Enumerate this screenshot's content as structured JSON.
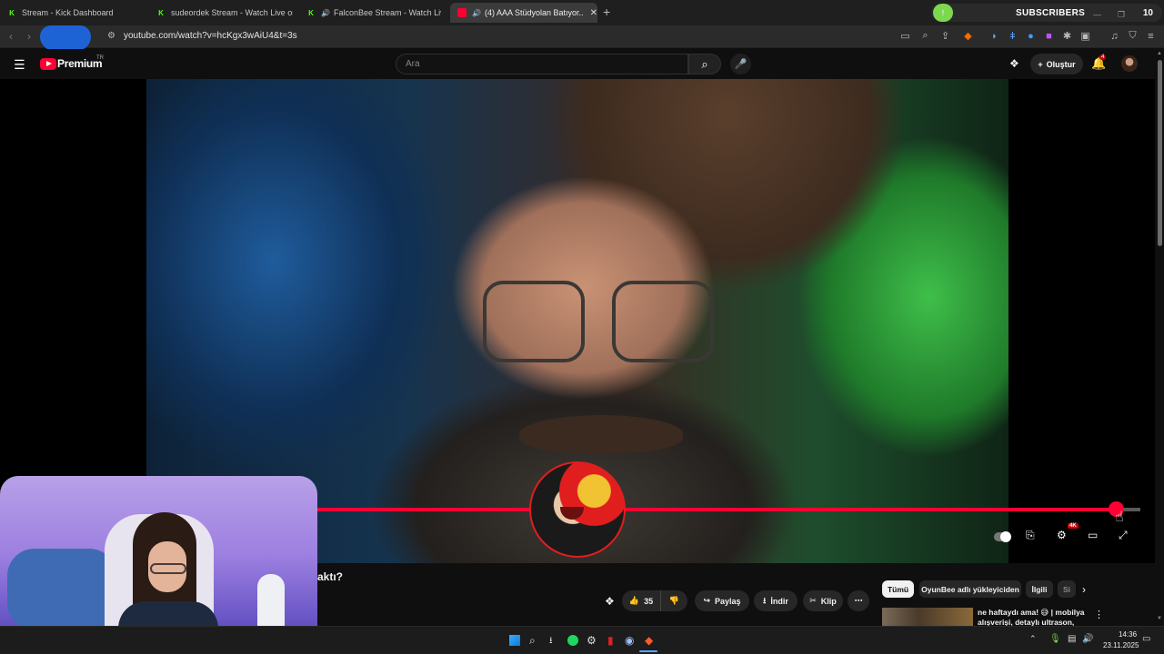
{
  "browser": {
    "tabs": [
      {
        "title": "Stream - Kick Dashboard"
      },
      {
        "title": "sudeordek Stream - Watch Live on K"
      },
      {
        "title": "FalconBee Stream - Watch Live on"
      },
      {
        "title": "(4) AAA Stüdyolan Batıyor..."
      }
    ],
    "url": "youtube.com/watch?v=hcKgx3wAiU4&t=3s"
  },
  "subs_widget": {
    "label": "SUBSCRIBERS",
    "count": "10"
  },
  "youtube": {
    "brand": "Premium",
    "region": "TR",
    "search_placeholder": "Ara",
    "create_label": "Oluştur",
    "notification_count": "4"
  },
  "player": {
    "progress": 0.97,
    "quality_badge": "4K",
    "colors": {
      "progress": "#ff0033"
    }
  },
  "video": {
    "title_fragment": "aktı?",
    "likes": "35",
    "share_label": "Paylaş",
    "download_label": "İndir",
    "clip_label": "Klip"
  },
  "chips": [
    "Tümü",
    "OyunBee adlı yükleyiciden",
    "İlgili",
    "Si"
  ],
  "recommendation": {
    "title": "ne haftaydı ama! 😅 | mobilya alışverişi, detaylı ultrason, bolc"
  },
  "taskbar": {
    "time": "14:36",
    "date": "23.11.2025"
  }
}
